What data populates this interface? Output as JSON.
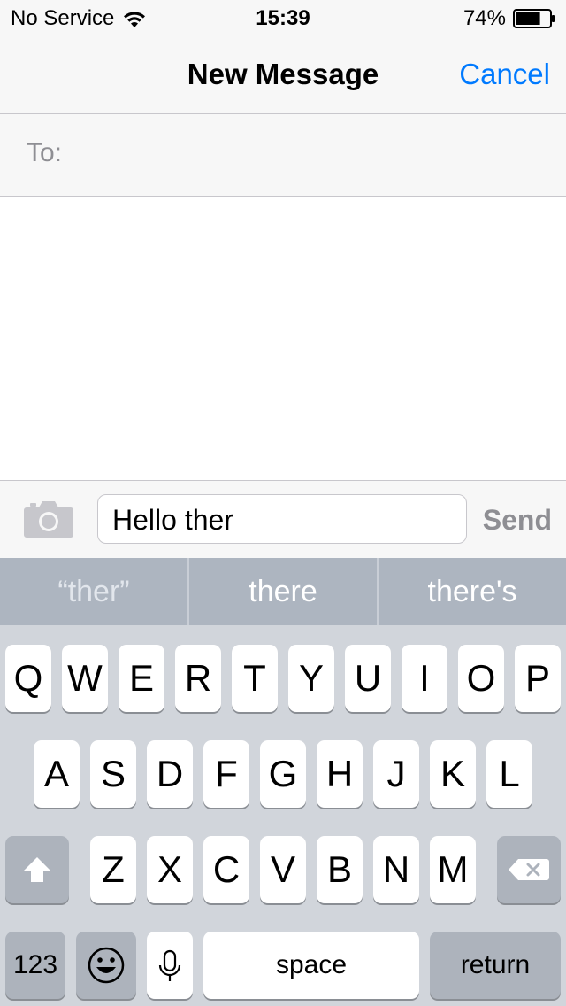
{
  "status_bar": {
    "carrier": "No Service",
    "time": "15:39",
    "battery_percent": "74%",
    "battery_level": 0.74,
    "wifi_icon": "wifi-icon",
    "battery_icon": "battery-icon"
  },
  "nav": {
    "title": "New Message",
    "cancel_label": "Cancel"
  },
  "to_field": {
    "label": "To:",
    "value": ""
  },
  "compose": {
    "camera_icon": "camera-icon",
    "message_value": "Hello ther",
    "send_label": "Send"
  },
  "suggestions": [
    "“ther”",
    "there",
    "there's"
  ],
  "keyboard": {
    "row1": [
      "Q",
      "W",
      "E",
      "R",
      "T",
      "Y",
      "U",
      "I",
      "O",
      "P"
    ],
    "row2": [
      "A",
      "S",
      "D",
      "F",
      "G",
      "H",
      "J",
      "K",
      "L"
    ],
    "row3": [
      "Z",
      "X",
      "C",
      "V",
      "B",
      "N",
      "M"
    ],
    "numbers_label": "123",
    "space_label": "space",
    "return_label": "return",
    "shift_icon": "shift-icon",
    "delete_icon": "delete-icon",
    "emoji_icon": "emoji-icon",
    "mic_icon": "microphone-icon"
  },
  "colors": {
    "accent": "#007aff",
    "bar_background": "#f7f7f7",
    "keyboard_background": "#d1d5db",
    "suggestion_background": "#adb5c0",
    "send_disabled": "#8e8e93"
  }
}
